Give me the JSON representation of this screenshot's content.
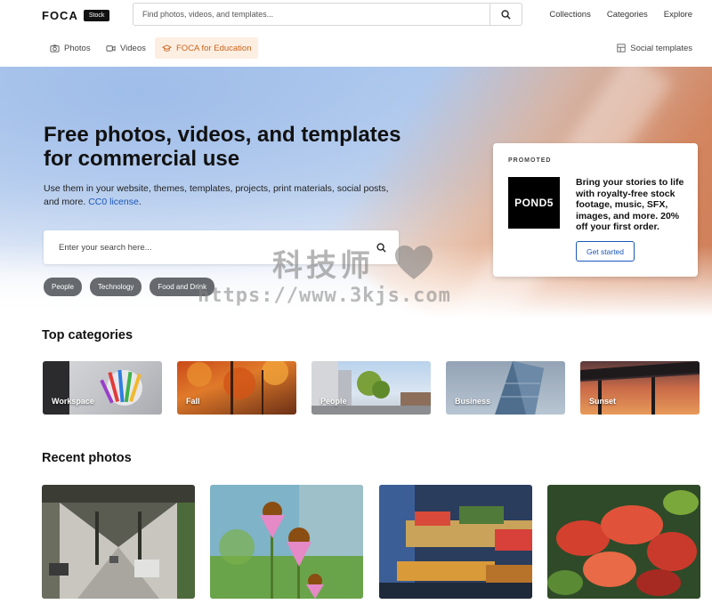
{
  "header": {
    "logo": "FOCA",
    "logo_badge": "Stock",
    "search_placeholder": "Find photos, videos, and templates...",
    "nav": [
      "Collections",
      "Categories",
      "Explore"
    ]
  },
  "subnav": {
    "tabs": [
      "Photos",
      "Videos",
      "FOCA for Education"
    ],
    "active_tab": "FOCA for Education",
    "social": "Social templates"
  },
  "hero": {
    "title_line1": "Free photos, videos, and templates",
    "title_line2": "for commercial use",
    "subtitle_line1": "Use them in your website, themes, templates, projects, print materials, social posts,",
    "subtitle_line2_prefix": "and more.",
    "license_link": "CC0 license",
    "subtitle_line2_suffix": ".",
    "search_placeholder": "Enter your search here...",
    "chips": [
      "People",
      "Technology",
      "Food and Drink"
    ]
  },
  "promo": {
    "label": "PROMOTED",
    "brand": "POND5",
    "text": "Bring your stories to life with royalty-free stock footage, music, SFX, images, and more. 20% off your first order.",
    "button": "Get started"
  },
  "watermark": {
    "cn_text": "科技师",
    "url": "https://www.3kjs.com"
  },
  "top_categories": {
    "title": "Top categories",
    "items": [
      "Workspace",
      "Fall",
      "People",
      "Business",
      "Sunset"
    ]
  },
  "recent_photos": {
    "title": "Recent photos"
  },
  "colors": {
    "accent": "#c8641a",
    "accent_bg": "#fdeee2",
    "link": "#1a57b8",
    "chip": "#666a6e"
  }
}
